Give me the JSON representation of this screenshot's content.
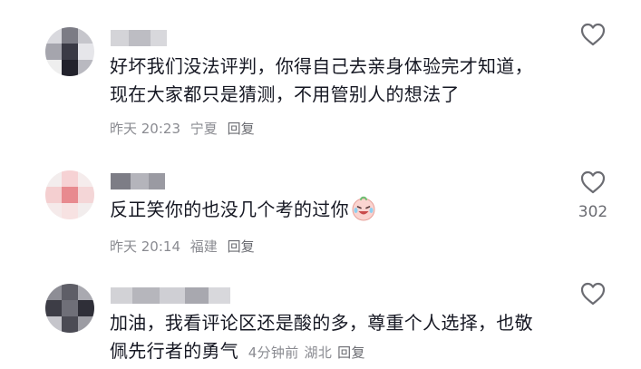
{
  "comments": [
    {
      "text": "好坏我们没法评判，你得自己去亲身体验完才知道，现在大家都只是猜测，不用管别人的想法了",
      "time": "昨天 20:23",
      "location": "宁夏",
      "reply_label": "回复",
      "likes": ""
    },
    {
      "text": "反正笑你的也没几个考的过你",
      "time": "昨天 20:14",
      "location": "福建",
      "reply_label": "回复",
      "likes": "302"
    },
    {
      "text": "加油，我看评论区还是酸的多，尊重个人选择，也敬佩先行者的勇气",
      "time": "4分钟前",
      "location": "湖北",
      "reply_label": "回复",
      "likes": ""
    }
  ],
  "icons": {
    "like": "heart-outline-icon",
    "emoji": "crying-laughing-emoji"
  },
  "colors": {
    "text": "#161823",
    "meta": "#8a8b91",
    "icon": "#6b6c72"
  }
}
